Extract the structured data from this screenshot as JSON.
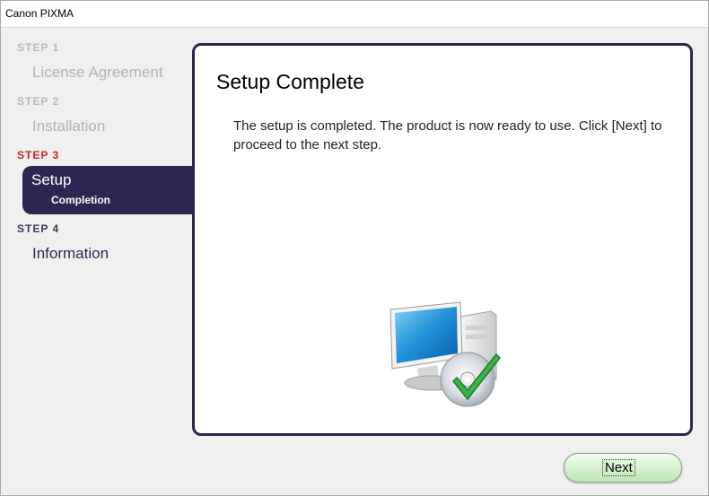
{
  "window": {
    "title": "Canon PIXMA"
  },
  "sidebar": {
    "steps": [
      {
        "step": "STEP 1",
        "title": "License Agreement",
        "state": "done"
      },
      {
        "step": "STEP 2",
        "title": "Installation",
        "state": "done"
      },
      {
        "step": "STEP 3",
        "title": "Setup",
        "subtitle": "Completion",
        "state": "active"
      },
      {
        "step": "STEP 4",
        "title": "Information",
        "state": "upcoming"
      }
    ]
  },
  "main": {
    "title": "Setup Complete",
    "message": "The setup is completed. The product is now ready to use. Click [Next] to proceed to the next step.",
    "illustration_icon": "computer-cd-checkmark-icon"
  },
  "footer": {
    "next_label": "Next"
  },
  "colors": {
    "accent": "#2d2552",
    "active_step": "#cc1e1e",
    "done_step": "#b3b3b3",
    "next_button": "#d3f0cc"
  }
}
